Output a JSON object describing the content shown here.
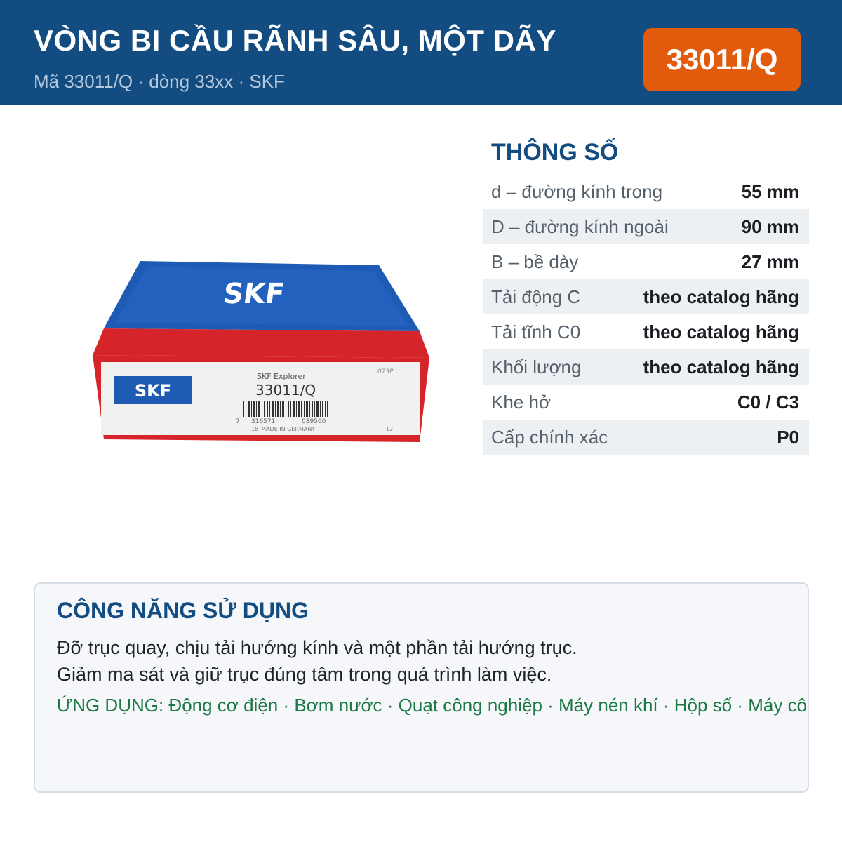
{
  "header": {
    "title": "VÒNG BI CẦU RÃNH SÂU, MỘT DÃY",
    "subtitle": "Mã 33011/Q · dòng 33xx · SKF",
    "code_badge": "33011/Q"
  },
  "product_image": {
    "brand_top": "SKF",
    "brand_label": "SKF",
    "label_line": "SKF Explorer",
    "model": "33011/Q",
    "barcode_left": "7",
    "barcode_mid": "316571",
    "barcode_right": "089560",
    "made_in": "18–MADE IN GERMANY",
    "corner_code": "073P",
    "corner_num": "12"
  },
  "specs": {
    "title": "THÔNG SỐ",
    "rows": [
      {
        "label": "d – đường kính trong",
        "value": "55 mm"
      },
      {
        "label": "D – đường kính ngoài",
        "value": "90 mm"
      },
      {
        "label": "B – bề dày",
        "value": "27 mm"
      },
      {
        "label": "Tải động C",
        "value": "theo catalog hãng"
      },
      {
        "label": "Tải tĩnh C0",
        "value": "theo catalog hãng"
      },
      {
        "label": "Khối lượng",
        "value": "theo catalog hãng"
      },
      {
        "label": "Khe hở",
        "value": "C0 / C3"
      },
      {
        "label": "Cấp chính xác",
        "value": "P0"
      }
    ]
  },
  "usage": {
    "title": "CÔNG NĂNG SỬ DỤNG",
    "line1": "Đỡ trục quay, chịu tải hướng kính và một phần tải hướng trục.",
    "line2": "Giảm ma sát và giữ trục đúng tâm trong quá trình làm việc.",
    "applications": "ỨNG DỤNG: Động cơ điện · Bơm nước · Quạt công nghiệp · Máy nén khí · Hộp số · Máy công cụ"
  },
  "colors": {
    "header_bg": "#134c80",
    "badge_bg": "#e25a0c",
    "accent_green": "#1d7a45",
    "skf_blue": "#1e5bb5",
    "skf_red": "#d6252a"
  }
}
